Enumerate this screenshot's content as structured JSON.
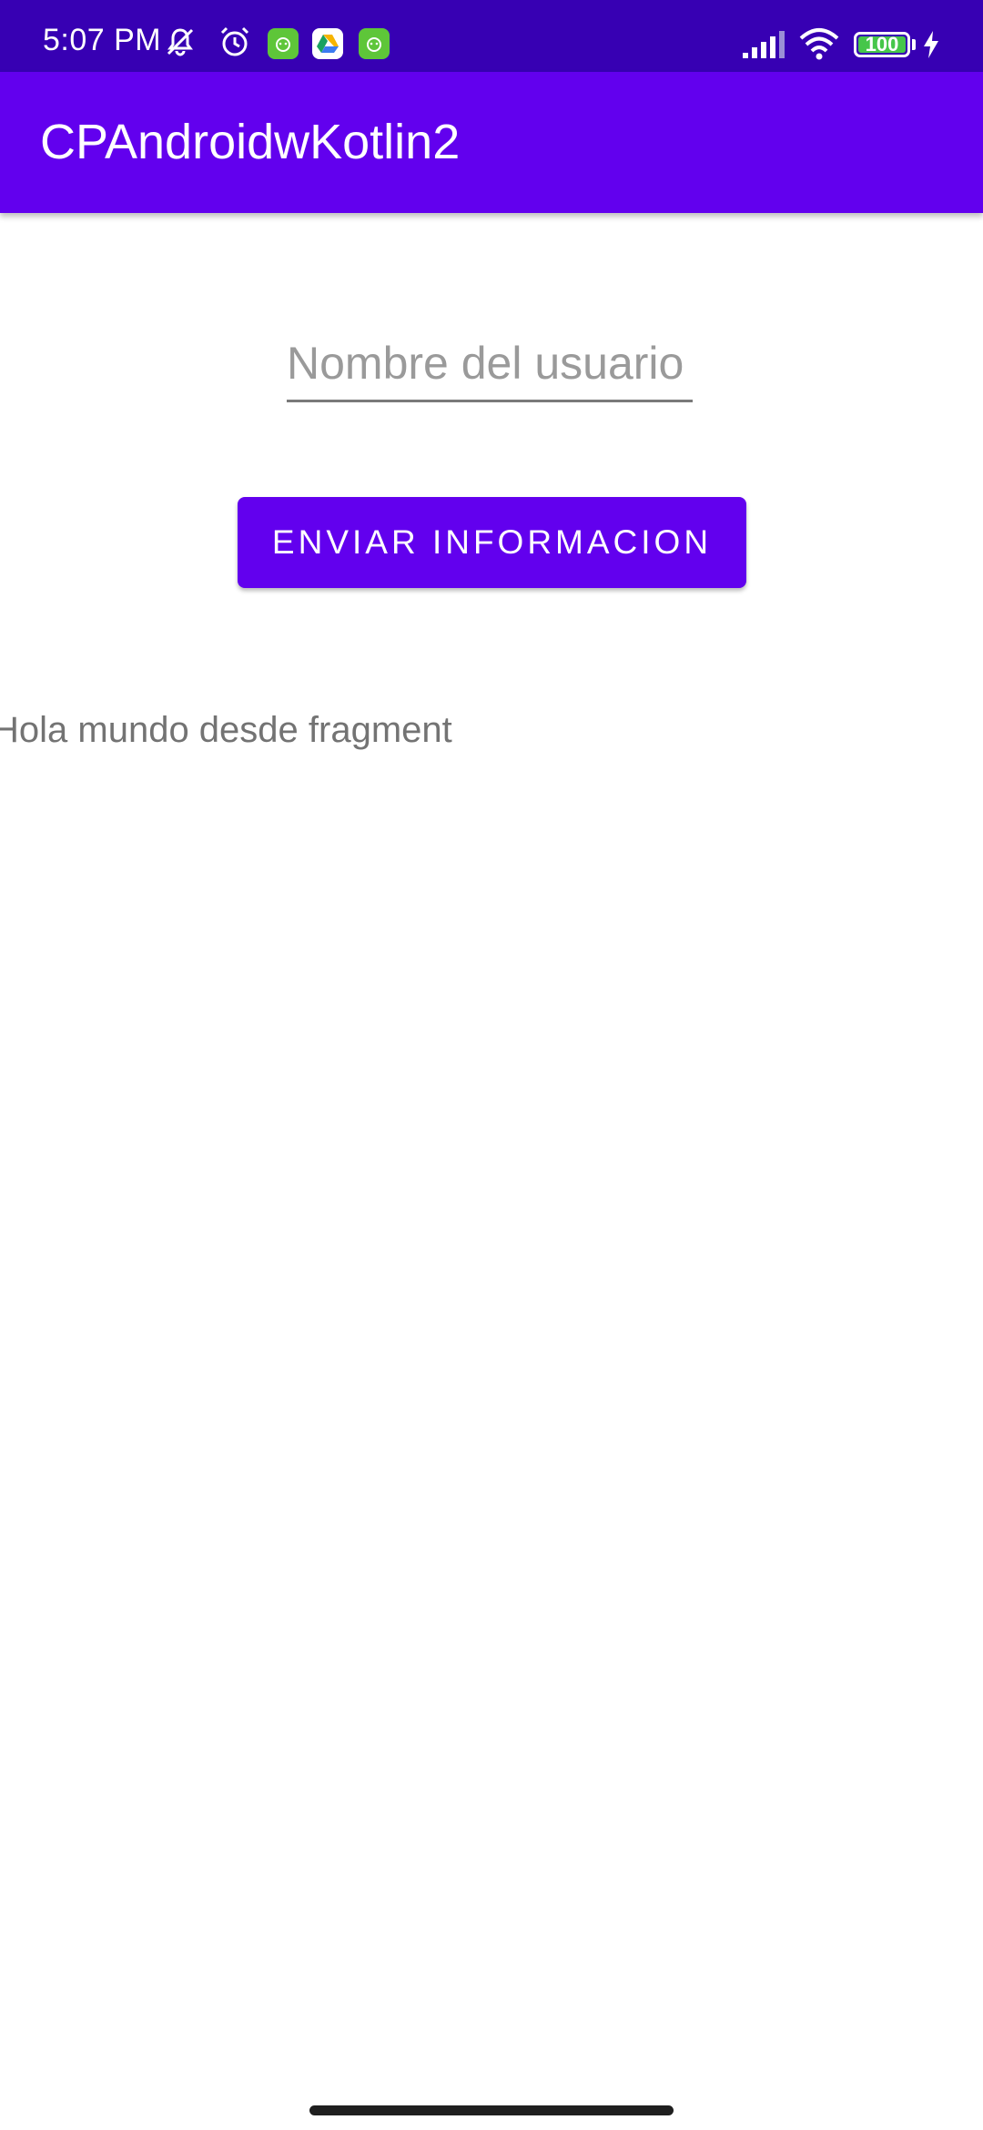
{
  "status_bar": {
    "time": "5:07 PM",
    "battery_level": "100",
    "icons": [
      "muted-bell-icon",
      "alarm-icon",
      "app-notification-icon",
      "drive-icon",
      "app-notification-icon",
      "cellular-signal-icon",
      "wifi-icon",
      "battery-icon",
      "charging-bolt-icon"
    ],
    "background_color": "#3700b3"
  },
  "app_bar": {
    "title": "CPAndroidwKotlin2",
    "background_color": "#6200ee"
  },
  "form": {
    "name_placeholder": "Nombre del usuario",
    "name_value": "",
    "send_button_label": "ENVIAR INFORMACION",
    "accent_color": "#6200ee"
  },
  "fragment": {
    "text": "Hola mundo desde fragment"
  }
}
